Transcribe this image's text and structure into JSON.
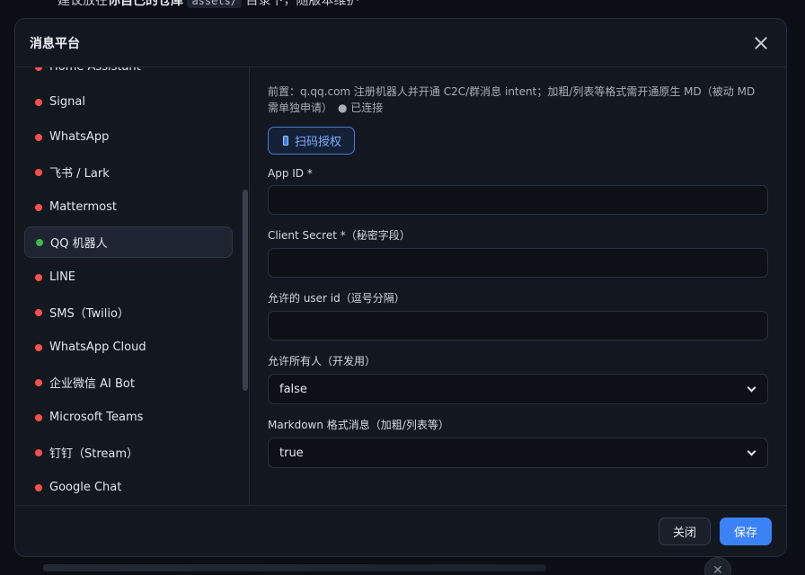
{
  "background": {
    "top_prefix": "建议放在",
    "top_bold": "你自己的仓库",
    "top_code": "assets/",
    "top_suffix": "目录下，随版本维护"
  },
  "modal": {
    "title": "消息平台",
    "close_label": "关闭",
    "save_label": "保存"
  },
  "colors": {
    "online": "#3fb950",
    "offline": "#f85149",
    "accent": "#3b82f6"
  },
  "sidebar": {
    "items": [
      {
        "label": "Home Assistant",
        "status": "offline"
      },
      {
        "label": "Signal",
        "status": "offline"
      },
      {
        "label": "WhatsApp",
        "status": "offline"
      },
      {
        "label": "飞书 / Lark",
        "status": "offline"
      },
      {
        "label": "Mattermost",
        "status": "offline"
      },
      {
        "label": "QQ 机器人",
        "status": "online",
        "active": true
      },
      {
        "label": "LINE",
        "status": "offline"
      },
      {
        "label": "SMS（Twilio）",
        "status": "offline"
      },
      {
        "label": "WhatsApp Cloud",
        "status": "offline"
      },
      {
        "label": "企业微信 AI Bot",
        "status": "offline"
      },
      {
        "label": "Microsoft Teams",
        "status": "offline"
      },
      {
        "label": "钉钉（Stream）",
        "status": "offline"
      },
      {
        "label": "Google Chat",
        "status": "offline"
      }
    ]
  },
  "form": {
    "hint": "前置：q.qq.com 注册机器人并开通 C2C/群消息 intent；加粗/列表等格式需开通原生 MD（被动 MD 需单独申请）",
    "status": "● 已连接",
    "scan_button": "扫码授权",
    "fields": {
      "app_id": {
        "label": "App ID *",
        "value": ""
      },
      "client_secret": {
        "label": "Client Secret *（秘密字段）",
        "value": ""
      },
      "allowed_users": {
        "label": "允许的 user id（逗号分隔）",
        "value": ""
      },
      "allow_all": {
        "label": "允许所有人（开发用）",
        "value": "false"
      },
      "markdown": {
        "label": "Markdown 格式消息（加粗/列表等）",
        "value": "true"
      }
    }
  }
}
